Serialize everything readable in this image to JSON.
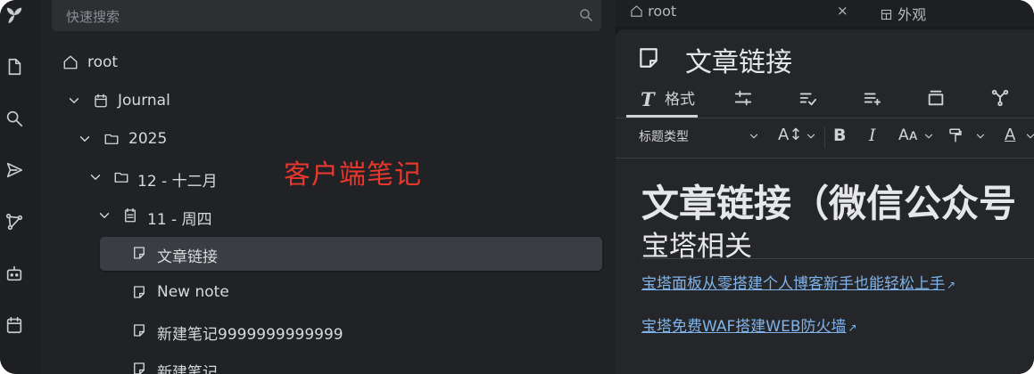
{
  "search": {
    "placeholder": "快速搜索"
  },
  "tree": [
    {
      "label": "root",
      "icon": "home-icon"
    },
    {
      "label": "Journal",
      "icon": "calendar-icon"
    },
    {
      "label": "2025",
      "icon": "folder-icon"
    },
    {
      "label": "12 - 十二月",
      "icon": "folder-icon"
    },
    {
      "label": "11 - 周四",
      "icon": "calendar-day-icon"
    },
    {
      "label": "文章链接",
      "icon": "note-icon",
      "selected": true
    },
    {
      "label": "New note",
      "icon": "note-icon"
    },
    {
      "label": "新建笔记9999999999999",
      "icon": "note-icon"
    },
    {
      "label": "新建笔记",
      "icon": "note-icon"
    }
  ],
  "annotation": "客户端笔记",
  "tabs": {
    "root": "root",
    "appearance": "外观",
    "close": "×"
  },
  "note": {
    "title": "文章链接",
    "format_tab": "格式",
    "heading_type": "标题类型",
    "h1": "文章链接（微信公众号",
    "h2": "宝塔相关",
    "links": [
      "宝塔面板从零搭建个人博客新手也能轻松上手",
      "宝塔免费WAF搭建WEB防火墙"
    ]
  },
  "colors": {
    "link": "#7fb3ea",
    "annotation": "#e8372c",
    "selected": "#3b3d42"
  }
}
